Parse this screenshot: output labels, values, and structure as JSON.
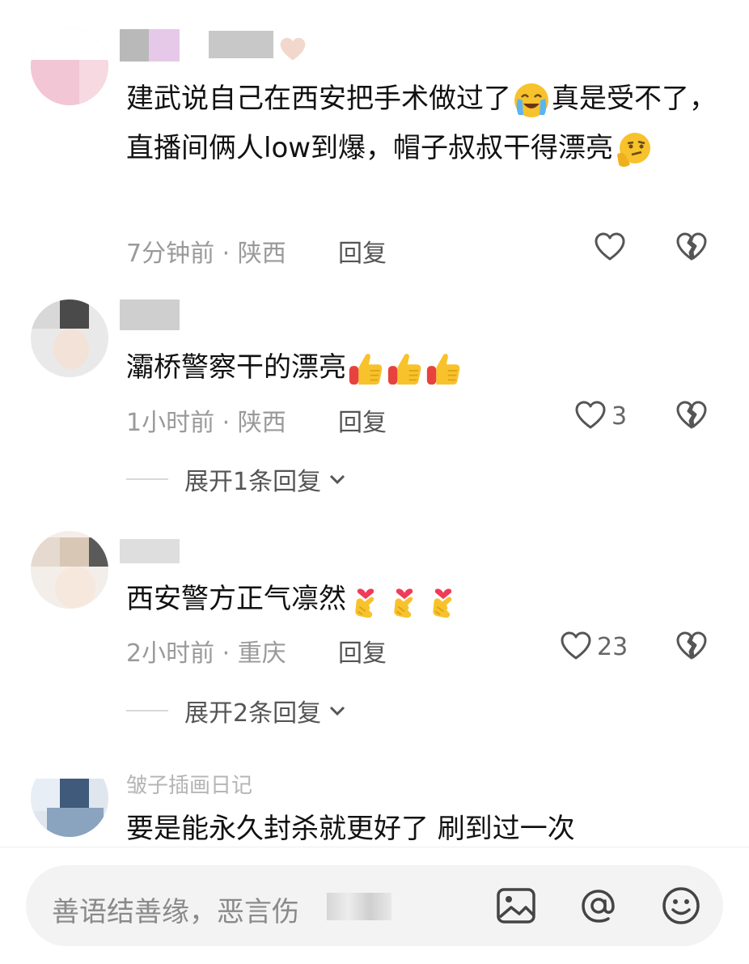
{
  "comments": [
    {
      "text_a": "建武说自己在西安把手术做过了",
      "emoji_a": "loudly-crying-face",
      "text_b": "真是受不了，直播间俩人low到爆，帽子叔叔干得漂亮",
      "emoji_b": "thinking-face",
      "time": "7分钟前 · 陕西",
      "reply": "回复",
      "likes": ""
    },
    {
      "text": "灞桥警察干的漂亮",
      "emojis": [
        "thumbs-up",
        "thumbs-up",
        "thumbs-up"
      ],
      "time": "1小时前 · 陕西",
      "reply": "回复",
      "likes": "3",
      "expand": "展开1条回复"
    },
    {
      "text": "西安警方正气凛然",
      "emojis": [
        "finger-heart",
        "finger-heart",
        "finger-heart"
      ],
      "time": "2小时前 · 重庆",
      "reply": "回复",
      "likes": "23",
      "expand": "展开2条回复"
    },
    {
      "username": "皱子插画日记",
      "text": "要是能永久封杀就更好了 刷到过一次"
    }
  ],
  "input": {
    "placeholder": "善语结善缘，恶言伤"
  },
  "icons": {
    "image": "image-icon",
    "mention": "at-icon",
    "emoji": "smiley-icon"
  }
}
